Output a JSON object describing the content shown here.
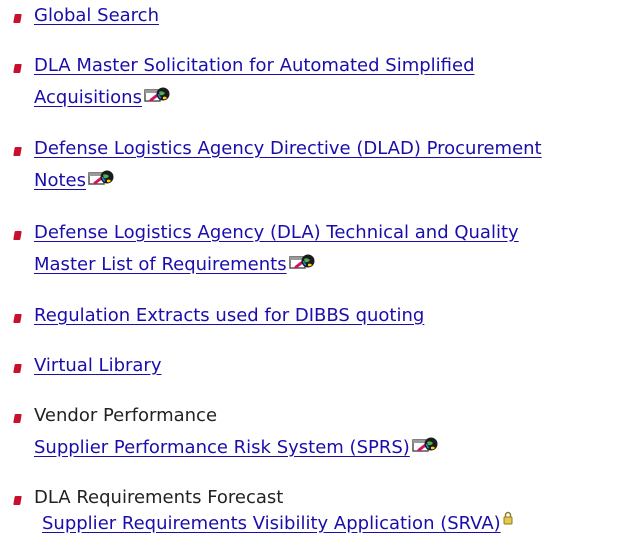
{
  "links": [
    {
      "label": "Global Search"
    },
    {
      "label_line1": "DLA Master Solicitation for Automated Simplified",
      "label_line2": "Acquisitions",
      "icon": "external-link-globe-icon"
    },
    {
      "label_line1": "Defense Logistics Agency Directive (DLAD) Procurement",
      "label_line2": "Notes",
      "icon": "external-link-globe-icon"
    },
    {
      "label_line1": "Defense Logistics Agency (DLA) Technical and Quality",
      "label_line2": "Master List of Requirements",
      "icon": "external-link-globe-icon"
    },
    {
      "label": "Regulation Extracts used for DIBBS quoting"
    },
    {
      "label": "Virtual Library"
    }
  ],
  "vendor_performance": {
    "heading": "Vendor Performance",
    "link_label": "Supplier Performance Risk System (SPRS)",
    "icon": "external-link-globe-icon"
  },
  "requirements_forecast": {
    "heading": "DLA Requirements Forecast",
    "link_label": "Supplier Requirements Visibility Application (SRVA)",
    "icon": "lock-icon"
  },
  "colors": {
    "link": "#1a0dab",
    "bullet": "#c8102e",
    "text": "#222222"
  }
}
